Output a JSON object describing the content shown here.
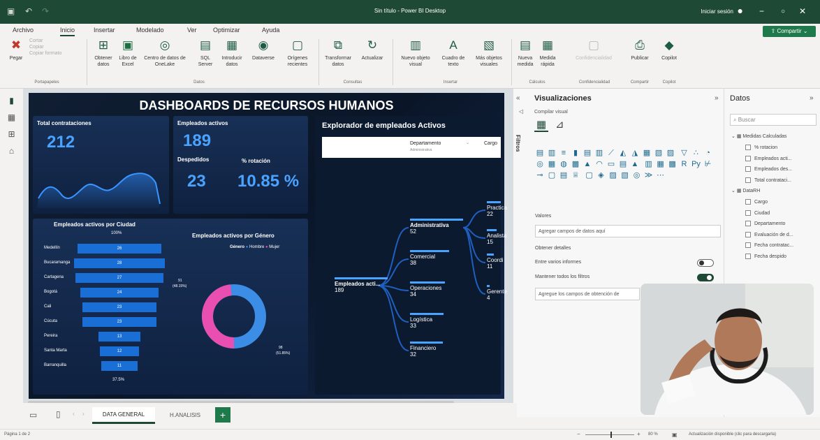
{
  "window": {
    "title": "Sin título - Power BI Desktop",
    "signin": "Iniciar sesión"
  },
  "menu": [
    "Archivo",
    "Inicio",
    "Insertar",
    "Modelado",
    "Ver",
    "Optimizar",
    "Ayuda"
  ],
  "share_label": "Compartir",
  "ribbon": {
    "paste": "Pegar",
    "cut": "Cortar",
    "copy": "Copiar",
    "format_painter": "Copiar formato",
    "get_data": "Obtener datos",
    "excel": "Libro de Excel",
    "onelake": "Centro de datos de OneLake",
    "sql": "SQL Server",
    "enter_data": "Introducir datos",
    "dataverse": "Dataverse",
    "recent": "Orígenes recientes",
    "transform": "Transformar datos",
    "refresh": "Actualizar",
    "new_visual": "Nuevo objeto visual",
    "textbox": "Cuadro de texto",
    "more_visuals": "Más objetos visuales",
    "new_measure": "Nueva medida",
    "quick_measure": "Medida rápida",
    "sensitivity": "Confidencialidad",
    "publish": "Publicar",
    "copilot": "Copilot",
    "groups": [
      "Portapapeles",
      "Datos",
      "Consultas",
      "Insertar",
      "Cálculos",
      "Confidencialidad",
      "Compartir",
      "Copilot"
    ]
  },
  "report": {
    "title": "DASHBOARDS DE RECURSOS HUMANOS",
    "total_hires_label": "Total contrataciones",
    "total_hires": "212",
    "active_label": "Empleados activos",
    "active": "189",
    "fired_label": "Despedidos",
    "fired": "23",
    "rotation_label": "% rotación",
    "rotation": "10.85 %",
    "funnel_title": "Empleados activos por Ciudad",
    "funnel_top": "100%",
    "funnel_bottom": "37.5%",
    "funnel": [
      {
        "city": "Medellín",
        "value": "26"
      },
      {
        "city": "Bucaramanga",
        "value": "28"
      },
      {
        "city": "Cartagena",
        "value": "27"
      },
      {
        "city": "Bogotá",
        "value": "24"
      },
      {
        "city": "Cali",
        "value": "23"
      },
      {
        "city": "Cúcuta",
        "value": "23"
      },
      {
        "city": "Pereira",
        "value": "13"
      },
      {
        "city": "Santa Marta",
        "value": "12"
      },
      {
        "city": "Barranquilla",
        "value": "11"
      }
    ],
    "gender_title": "Empleados activos por Género",
    "gender_legend": "Género",
    "gender_male": "Hombre",
    "gender_female": "Mujer",
    "gender_f_label": "91",
    "gender_f_pct": "(48.15%)",
    "gender_m_label": "98",
    "gender_m_pct": "(51.85%)",
    "tree_title": "Explorador de empleados Activos",
    "tree_col1": "Departamento",
    "tree_col1_sub": "Administrativa",
    "tree_col2": "Cargo",
    "tree_root": "Empleados acti...",
    "tree_root_val": "189",
    "tree_depts": [
      {
        "name": "Administrativa",
        "val": "52"
      },
      {
        "name": "Comercial",
        "val": "38"
      },
      {
        "name": "Operaciones",
        "val": "34"
      },
      {
        "name": "Logística",
        "val": "33"
      },
      {
        "name": "Financiero",
        "val": "32"
      }
    ],
    "tree_roles": [
      {
        "name": "Practica",
        "val": "22"
      },
      {
        "name": "Analista",
        "val": "15"
      },
      {
        "name": "Coordi",
        "val": "11"
      },
      {
        "name": "Gerente",
        "val": "4"
      }
    ]
  },
  "viz": {
    "filters": "Filtros",
    "title": "Visualizaciones",
    "build": "Compilar visual",
    "values": "Valores",
    "values_ph": "Agregar campos de datos aquí",
    "drill": "Obtener detalles",
    "cross": "Entre varios informes",
    "keep": "Mantener todos los filtros",
    "drill_ph": "Agregue los campos de obtención de"
  },
  "data": {
    "title": "Datos",
    "search": "Buscar",
    "tables": [
      {
        "name": "Medidas Calculadas",
        "fields": [
          "% rotacion",
          "Empleados acti...",
          "Empleados des...",
          "Total contrataci..."
        ]
      },
      {
        "name": "DataRH",
        "fields": [
          "Cargo",
          "Ciudad",
          "Departamento",
          "Evaluación de d...",
          "Fecha contratac...",
          "Fecha despido"
        ]
      }
    ]
  },
  "tabs": [
    "DATA GENERAL",
    "H.ANALISIS"
  ],
  "status": {
    "page": "Página 1 de 2",
    "zoom": "80 %",
    "update": "Actualización disponible (clic para descargarla)"
  }
}
